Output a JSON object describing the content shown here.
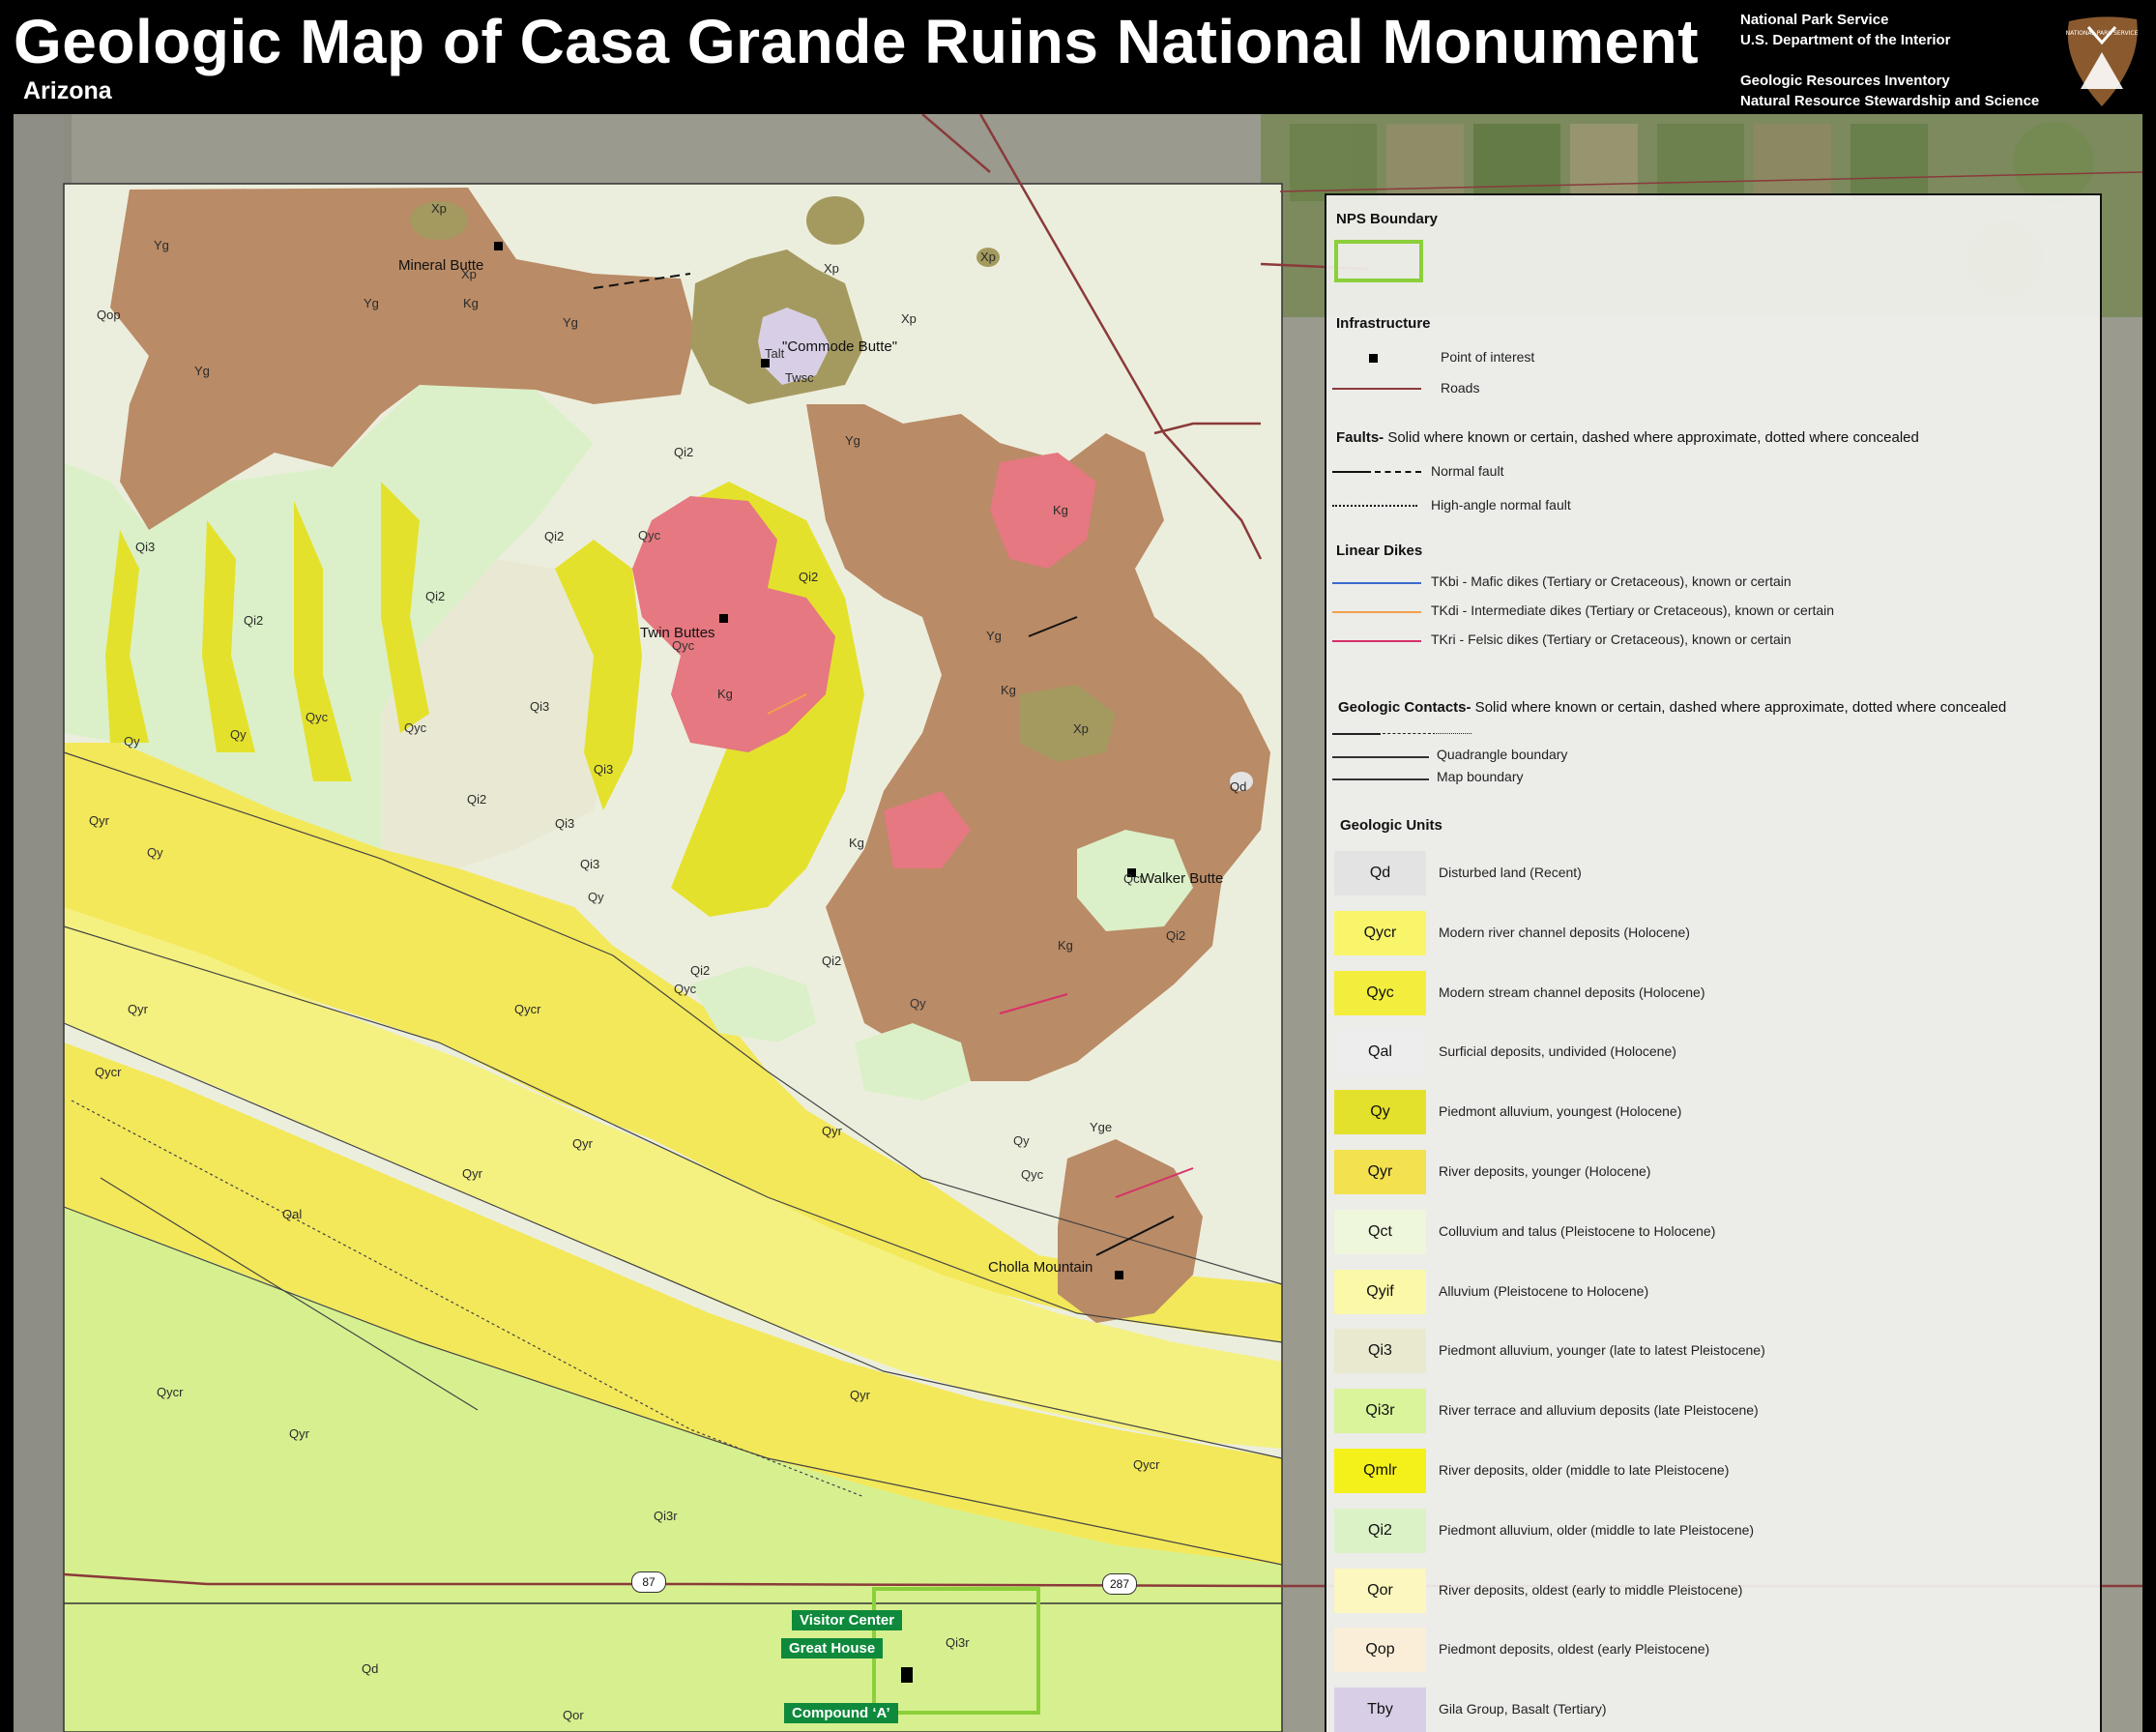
{
  "header": {
    "title": "Geologic Map of Casa Grande Ruins National Monument",
    "subtitle": "Arizona",
    "agency1": "National Park Service",
    "agency2": "U.S. Department of the Interior",
    "program1": "Geologic Resources Inventory",
    "program2": "Natural Resource Stewardship and Science",
    "logo_text": "NATIONAL PARK SERVICE"
  },
  "colors": {
    "Yg": "#b98b66",
    "Kg": "#e57880",
    "Xp": "#a49a5f",
    "Qy": "#e4e12c",
    "Qycr": "#f4f180",
    "Qyr": "#f3e85a",
    "Qi2": "#dbf0c8",
    "Qi3": "#e9e9d3",
    "Qi3r": "#d6f08f",
    "Qal": "#ededed",
    "bg": "#eceedd",
    "road": "#8a3a3a"
  },
  "legend": {
    "nps": {
      "title": "NPS Boundary"
    },
    "infra": {
      "title": "Infrastructure",
      "poi": "Point of interest",
      "roads": "Roads"
    },
    "faults": {
      "title": "Faults-",
      "desc": " Solid where known or certain, dashed where approximate, dotted where concealed",
      "normal": "Normal fault",
      "high": "High-angle normal fault"
    },
    "dikes": {
      "title": "Linear Dikes",
      "d1": "TKbi - Mafic dikes (Tertiary or Cretaceous), known or certain",
      "d2": "TKdi - Intermediate dikes (Tertiary or Cretaceous), known or certain",
      "d3": "TKri - Felsic dikes (Tertiary or Cretaceous), known or certain"
    },
    "contacts": {
      "title": "Geologic Contacts-",
      "desc": " Solid where known or certain, dashed where approximate, dotted where concealed",
      "quad": "Quadrangle boundary",
      "map": "Map boundary"
    },
    "units_title": "Geologic Units",
    "units": [
      {
        "code": "Qd",
        "desc": "Disturbed land (Recent)",
        "color": "#e3e3e3"
      },
      {
        "code": "Qycr",
        "desc": "Modern river channel deposits (Holocene)",
        "color": "#f8f56a"
      },
      {
        "code": "Qyc",
        "desc": "Modern stream channel deposits (Holocene)",
        "color": "#f3ee3d"
      },
      {
        "code": "Qal",
        "desc": "Surficial deposits, undivided (Holocene)",
        "color": "#ededed"
      },
      {
        "code": "Qy",
        "desc": "Piedmont alluvium, youngest (Holocene)",
        "color": "#e4e12c"
      },
      {
        "code": "Qyr",
        "desc": "River deposits, younger (Holocene)",
        "color": "#f3e14f"
      },
      {
        "code": "Qct",
        "desc": "Colluvium and talus (Pleistocene to Holocene)",
        "color": "#eef6dc"
      },
      {
        "code": "Qyif",
        "desc": "Alluvium (Pleistocene to Holocene)",
        "color": "#fbf8a8"
      },
      {
        "code": "Qi3",
        "desc": "Piedmont alluvium, younger (late to latest Pleistocene)",
        "color": "#e9e9cf"
      },
      {
        "code": "Qi3r",
        "desc": "River terrace and alluvium deposits (late Pleistocene)",
        "color": "#d9f49a"
      },
      {
        "code": "Qmlr",
        "desc": "River deposits, older (middle to late Pleistocene)",
        "color": "#f4f11a"
      },
      {
        "code": "Qi2",
        "desc": "Piedmont alluvium, older (middle to late Pleistocene)",
        "color": "#dbf2c6"
      },
      {
        "code": "Qor",
        "desc": "River deposits, oldest (early to middle Pleistocene)",
        "color": "#fbf7bf"
      },
      {
        "code": "Qop",
        "desc": "Piedmont deposits, oldest (early Pleistocene)",
        "color": "#faeed8"
      },
      {
        "code": "Tby",
        "desc": "Gila Group, Basalt (Tertiary)",
        "color": "#d8cfe6"
      }
    ]
  },
  "places": {
    "mineral_butte": "Mineral Butte",
    "commode_butte": "\"Commode Butte\"",
    "twin_buttes": "Twin Buttes",
    "walker_butte": "Walker Butte",
    "cholla_mountain": "Cholla Mountain"
  },
  "callouts": {
    "visitor_center": "Visitor Center",
    "great_house": "Great House",
    "compound_a": "Compound ‘A’"
  },
  "highways": {
    "h1": "87",
    "h2": "287"
  },
  "unit_labels": [
    {
      "t": "Yg"
    },
    {
      "t": "Yg"
    },
    {
      "t": "Yg"
    },
    {
      "t": "Yg"
    },
    {
      "t": "Yg"
    },
    {
      "t": "Yg"
    },
    {
      "t": "Xp"
    },
    {
      "t": "Xp"
    },
    {
      "t": "Xp"
    },
    {
      "t": "Xp"
    },
    {
      "t": "Xp"
    },
    {
      "t": "Xp"
    },
    {
      "t": "Kg"
    },
    {
      "t": "Kg"
    },
    {
      "t": "Kg"
    },
    {
      "t": "Kg"
    },
    {
      "t": "Kg"
    },
    {
      "t": "Kg"
    },
    {
      "t": "Qi3"
    },
    {
      "t": "Qi3"
    },
    {
      "t": "Qi3"
    },
    {
      "t": "Qi3"
    },
    {
      "t": "Qi3"
    },
    {
      "t": "Qi2"
    },
    {
      "t": "Qi2"
    },
    {
      "t": "Qi2"
    },
    {
      "t": "Qi2"
    },
    {
      "t": "Qi2"
    },
    {
      "t": "Qi2"
    },
    {
      "t": "Qi2"
    },
    {
      "t": "Qi2"
    },
    {
      "t": "Qi2"
    },
    {
      "t": "Qy"
    },
    {
      "t": "Qy"
    },
    {
      "t": "Qy"
    },
    {
      "t": "Qy"
    },
    {
      "t": "Qy"
    },
    {
      "t": "Qy"
    },
    {
      "t": "Qyc"
    },
    {
      "t": "Qyc"
    },
    {
      "t": "Qyc"
    },
    {
      "t": "Qyc"
    },
    {
      "t": "Qyc"
    },
    {
      "t": "Qyc"
    },
    {
      "t": "Qyr"
    },
    {
      "t": "Qyr"
    },
    {
      "t": "Qyr"
    },
    {
      "t": "Qyr"
    },
    {
      "t": "Qyr"
    },
    {
      "t": "Qyr"
    },
    {
      "t": "Qyr"
    },
    {
      "t": "Qycr"
    },
    {
      "t": "Qycr"
    },
    {
      "t": "Qycr"
    },
    {
      "t": "Qycr"
    },
    {
      "t": "Qi3r"
    },
    {
      "t": "Qi3r"
    },
    {
      "t": "Qd"
    },
    {
      "t": "Qd"
    },
    {
      "t": "Qor"
    },
    {
      "t": "Qop"
    },
    {
      "t": "Qct"
    },
    {
      "t": "Talt"
    },
    {
      "t": "Twsc"
    },
    {
      "t": "Yge"
    },
    {
      "t": "Qal"
    }
  ]
}
